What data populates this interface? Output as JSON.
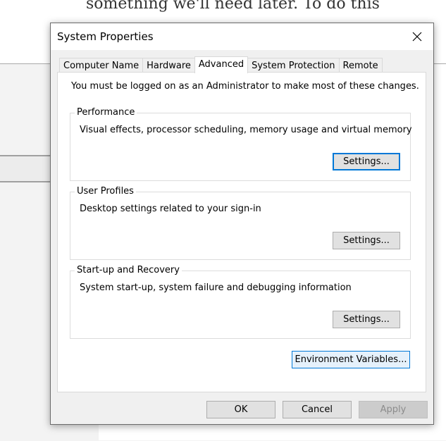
{
  "background": {
    "text": "something we'll need later. To do this"
  },
  "dialog": {
    "title": "System Properties",
    "tabs": [
      {
        "label": "Computer Name",
        "active": false
      },
      {
        "label": "Hardware",
        "active": false
      },
      {
        "label": "Advanced",
        "active": true
      },
      {
        "label": "System Protection",
        "active": false
      },
      {
        "label": "Remote",
        "active": false
      }
    ],
    "notice": "You must be logged on as an Administrator to make most of these changes.",
    "groups": [
      {
        "title": "Performance",
        "description": "Visual effects, processor scheduling, memory usage and virtual memory",
        "button": "Settings..."
      },
      {
        "title": "User Profiles",
        "description": "Desktop settings related to your sign-in",
        "button": "Settings..."
      },
      {
        "title": "Start-up and Recovery",
        "description": "System start-up, system failure and debugging information",
        "button": "Settings..."
      }
    ],
    "env_button": "Environment Variables...",
    "footer": {
      "ok": "OK",
      "cancel": "Cancel",
      "apply": "Apply"
    }
  },
  "colors": {
    "accent": "#0078d7",
    "dialog_bg": "#f0f0f0",
    "disabled_text": "#8c8c8c"
  }
}
